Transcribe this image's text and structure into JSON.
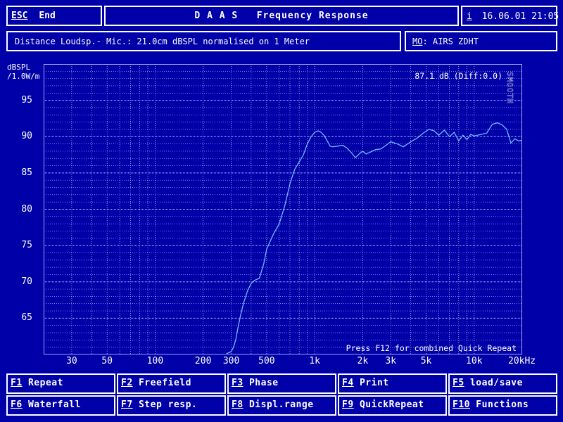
{
  "header": {
    "esc_key": "ESC",
    "esc_label": "End",
    "title": "D A A S   Frequency Response",
    "info_key": "i",
    "datetime": "16.06.01 21:05"
  },
  "subheader": {
    "description": "Distance Loudsp.- Mic.: 21.0cm dBSPL normalised on 1 Meter",
    "memory_key": "MO",
    "memory_name": ": AIRS ZDHT"
  },
  "plot": {
    "y_unit_line1": "dBSPL",
    "y_unit_line2": "/1.0W/m",
    "readout": "87.1 dB (Diff:0.0)",
    "smooth_label": "SMOOTH",
    "footer_hint": "Press F12 for combined Quick Repeat"
  },
  "chart_data": {
    "type": "line",
    "x_scale": "log",
    "xlim": [
      20,
      20000
    ],
    "ylim": [
      60,
      100
    ],
    "ylabel": "dBSPL /1.0W/m",
    "grid": true,
    "x_ticks": [
      30,
      50,
      100,
      200,
      300,
      500,
      1000,
      2000,
      3000,
      5000,
      10000,
      20000
    ],
    "x_tick_labels": [
      "30",
      "50",
      "100",
      "200",
      "300",
      "500",
      "1k",
      "2k",
      "3k",
      "5k",
      "10k",
      "20kHz"
    ],
    "y_ticks": [
      65,
      70,
      75,
      80,
      85,
      90,
      95
    ],
    "series": [
      {
        "color": "#70b8ff",
        "x": [
          280,
          300,
          310,
          320,
          330,
          340,
          350,
          360,
          380,
          400,
          420,
          450,
          480,
          500,
          550,
          600,
          650,
          700,
          750,
          800,
          850,
          900,
          950,
          1000,
          1050,
          1100,
          1150,
          1200,
          1250,
          1300,
          1400,
          1500,
          1600,
          1700,
          1800,
          1900,
          2000,
          2100,
          2200,
          2400,
          2600,
          2800,
          3000,
          3300,
          3600,
          4000,
          4400,
          4800,
          5200,
          5600,
          6000,
          6500,
          7000,
          7500,
          8000,
          8500,
          9000,
          9500,
          10000,
          11000,
          12000,
          13000,
          14000,
          15000,
          16000,
          17000,
          18000,
          19000,
          20000
        ],
        "y": [
          60.1,
          60.4,
          61,
          62,
          63.6,
          65,
          66.2,
          67.2,
          68.8,
          69.8,
          70.2,
          70.5,
          72.5,
          74.5,
          76.5,
          78,
          80.5,
          83.5,
          85.5,
          86.5,
          87.5,
          89,
          90,
          90.6,
          90.8,
          90.6,
          90.1,
          89.4,
          88.7,
          88.6,
          88.7,
          88.8,
          88.4,
          87.8,
          87.1,
          87.6,
          88,
          87.6,
          87.8,
          88.2,
          88.3,
          88.8,
          89.3,
          89,
          88.6,
          89.3,
          89.8,
          90.5,
          91,
          90.8,
          90.2,
          90.9,
          90,
          90.6,
          89.4,
          90.2,
          89.6,
          90.3,
          90.1,
          90.3,
          90.5,
          91.7,
          91.9,
          91.6,
          91,
          89.1,
          89.7,
          89.4,
          89.5
        ]
      }
    ]
  },
  "fkeys": [
    {
      "key": "F1",
      "label": " Repeat"
    },
    {
      "key": "F2",
      "label": " Freefield"
    },
    {
      "key": "F3",
      "label": " Phase"
    },
    {
      "key": "F4",
      "label": " Print"
    },
    {
      "key": "F5",
      "label": " load/save"
    },
    {
      "key": "F6",
      "label": " Waterfall"
    },
    {
      "key": "F7",
      "label": " Step resp."
    },
    {
      "key": "F8",
      "label": " Displ.range"
    },
    {
      "key": "F9",
      "label": " QuickRepeat"
    },
    {
      "key": "F10",
      "label": " Functions"
    }
  ]
}
